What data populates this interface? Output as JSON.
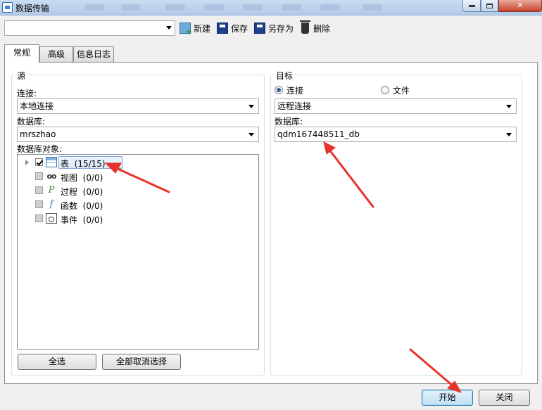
{
  "window": {
    "title": "数据传输",
    "controls": {
      "minimize": "0",
      "maximize": "1",
      "close": "r"
    }
  },
  "toolbar": {
    "profile_value": "",
    "new_label": "新建",
    "save_label": "保存",
    "save_as_label": "另存为",
    "delete_label": "删除"
  },
  "tabs": [
    {
      "label": "常规",
      "active": true
    },
    {
      "label": "高级",
      "active": false
    },
    {
      "label": "信息日志",
      "active": false
    }
  ],
  "source": {
    "group_title": "源",
    "connection_label": "连接:",
    "connection_value": "本地连接",
    "database_label": "数据库:",
    "database_value": "mrszhao",
    "objects_label": "数据库对象:",
    "tree": [
      {
        "name": "表",
        "count": "(15/15)",
        "checked": true,
        "icon": "table-icon"
      },
      {
        "name": "视图",
        "count": "(0/0)",
        "checked": false,
        "icon": "view-icon"
      },
      {
        "name": "过程",
        "count": "(0/0)",
        "checked": false,
        "icon": "procedure-icon"
      },
      {
        "name": "函数",
        "count": "(0/0)",
        "checked": false,
        "icon": "function-icon"
      },
      {
        "name": "事件",
        "count": "(0/0)",
        "checked": false,
        "icon": "event-icon"
      }
    ],
    "select_all_label": "全选",
    "deselect_all_label": "全部取消选择"
  },
  "target": {
    "group_title": "目标",
    "radio_connection_label": "连接",
    "radio_file_label": "文件",
    "selected_mode": "connection",
    "connection_value": "远程连接",
    "database_label": "数据库:",
    "database_value": "qdm167448511_db"
  },
  "footer": {
    "start_label": "开始",
    "close_label": "关闭"
  },
  "colors": {
    "annotation_arrow": "#e8322b",
    "titlebar": "#b3cbe8",
    "default_button": "#bfe0f5"
  }
}
